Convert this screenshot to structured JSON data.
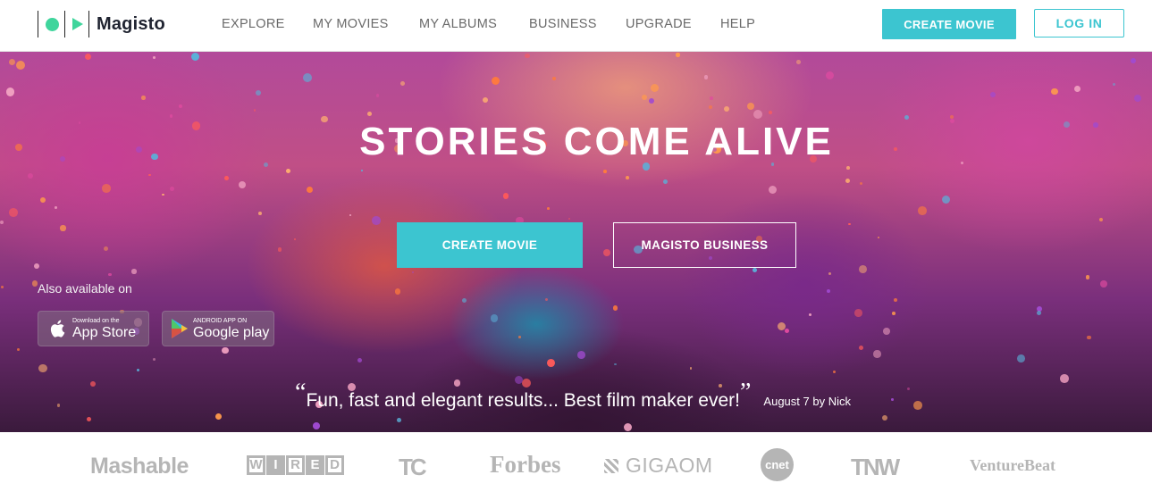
{
  "header": {
    "brand": "Magisto",
    "nav": [
      "EXPLORE",
      "MY MOVIES",
      "MY ALBUMS",
      "BUSINESS",
      "UPGRADE",
      "HELP"
    ],
    "create_movie": "CREATE MOVIE",
    "login": "LOG IN"
  },
  "hero": {
    "title": "STORIES COME ALIVE",
    "create_movie": "CREATE MOVIE",
    "business": "MAGISTO BUSINESS",
    "also_available": "Also available on",
    "appstore_small": "Download on the",
    "appstore_big": "App Store",
    "gplay_small": "ANDROID APP ON",
    "gplay_big": "Google play",
    "quote_open": "“",
    "quote_text": "Fun, fast and elegant results... Best film maker ever!",
    "quote_close": "”",
    "quote_by": "August 7 by Nick"
  },
  "press": {
    "logos": [
      "Mashable",
      "WIRED",
      "TC",
      "Forbes",
      "GIGAOM",
      "cnet",
      "TNW",
      "VentureBeat"
    ]
  },
  "colors": {
    "accent": "#3cc5d0",
    "logo_green": "#3fd59c",
    "press_gray": "#b5b5b5"
  }
}
